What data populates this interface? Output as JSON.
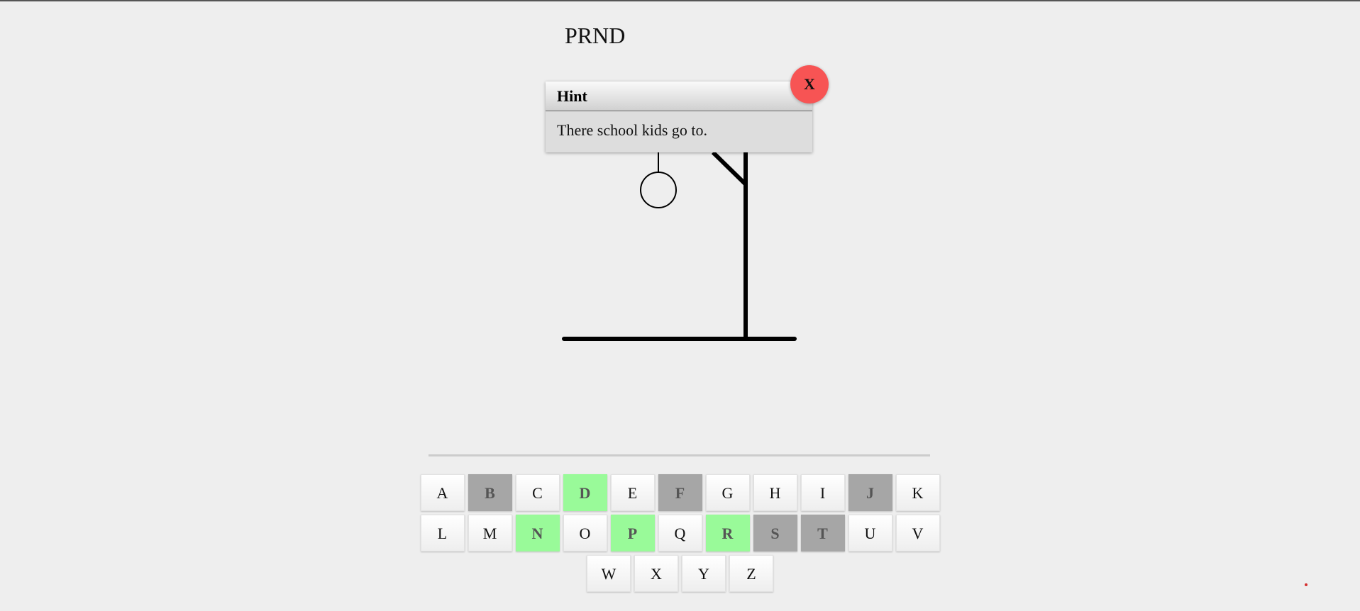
{
  "word": {
    "slots": [
      "P",
      "",
      "",
      "",
      "",
      "R",
      "",
      "",
      "N",
      "D"
    ]
  },
  "hint": {
    "title": "Hint",
    "text": "There school kids go to.",
    "close_label": "X"
  },
  "keyboard": {
    "rows": [
      [
        {
          "letter": "A",
          "state": "unused"
        },
        {
          "letter": "B",
          "state": "wrong"
        },
        {
          "letter": "C",
          "state": "unused"
        },
        {
          "letter": "D",
          "state": "correct"
        },
        {
          "letter": "E",
          "state": "unused"
        },
        {
          "letter": "F",
          "state": "wrong"
        },
        {
          "letter": "G",
          "state": "unused"
        },
        {
          "letter": "H",
          "state": "unused"
        },
        {
          "letter": "I",
          "state": "unused"
        },
        {
          "letter": "J",
          "state": "wrong"
        },
        {
          "letter": "K",
          "state": "unused"
        }
      ],
      [
        {
          "letter": "L",
          "state": "unused"
        },
        {
          "letter": "M",
          "state": "unused"
        },
        {
          "letter": "N",
          "state": "correct"
        },
        {
          "letter": "O",
          "state": "unused"
        },
        {
          "letter": "P",
          "state": "correct"
        },
        {
          "letter": "Q",
          "state": "unused"
        },
        {
          "letter": "R",
          "state": "correct"
        },
        {
          "letter": "S",
          "state": "wrong"
        },
        {
          "letter": "T",
          "state": "wrong"
        },
        {
          "letter": "U",
          "state": "unused"
        },
        {
          "letter": "V",
          "state": "unused"
        }
      ],
      [
        {
          "letter": "W",
          "state": "unused"
        },
        {
          "letter": "X",
          "state": "unused"
        },
        {
          "letter": "Y",
          "state": "unused"
        },
        {
          "letter": "Z",
          "state": "unused"
        }
      ]
    ]
  },
  "colors": {
    "correct": "#99fa99",
    "wrong": "#a6a6a6",
    "close_button": "#f75454",
    "background": "#eeeeee"
  },
  "drawing": {
    "parts_shown": [
      "base",
      "pole",
      "brace",
      "rope",
      "head"
    ]
  }
}
